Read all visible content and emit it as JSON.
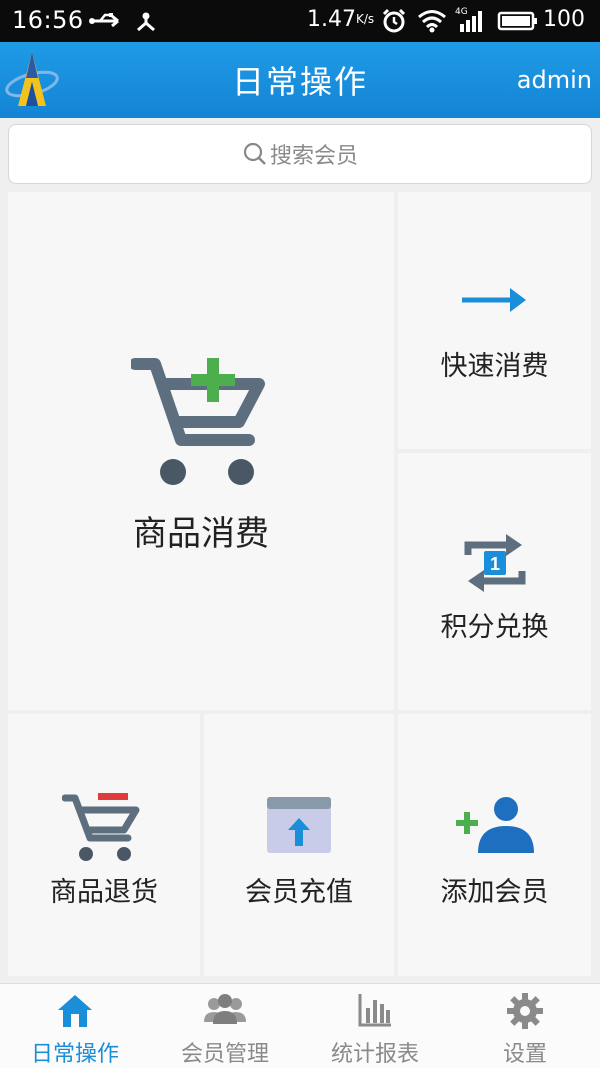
{
  "status": {
    "time": "16:56",
    "net_speed": "1.47",
    "net_unit": "K/s",
    "network_type": "4G",
    "battery": "100"
  },
  "header": {
    "title": "日常操作",
    "user": "admin"
  },
  "search": {
    "placeholder": "搜索会员"
  },
  "tiles": [
    {
      "label": "商品消费",
      "icon": "cart-add-icon"
    },
    {
      "label": "快速消费",
      "icon": "arrow-right-icon"
    },
    {
      "label": "积分兑换",
      "icon": "exchange-icon"
    },
    {
      "label": "商品退货",
      "icon": "cart-remove-icon"
    },
    {
      "label": "会员充值",
      "icon": "recharge-icon"
    },
    {
      "label": "添加会员",
      "icon": "add-member-icon"
    }
  ],
  "exchange_badge": "1",
  "nav": [
    {
      "label": "日常操作",
      "icon": "home-icon",
      "active": true
    },
    {
      "label": "会员管理",
      "icon": "members-icon"
    },
    {
      "label": "统计报表",
      "icon": "chart-icon"
    },
    {
      "label": "设置",
      "icon": "gear-icon"
    }
  ],
  "colors": {
    "header": "#1f9be6",
    "accent": "#1a8ed8",
    "green": "#4cae4c",
    "red": "#e0393e",
    "slate": "#5d6f7e"
  }
}
